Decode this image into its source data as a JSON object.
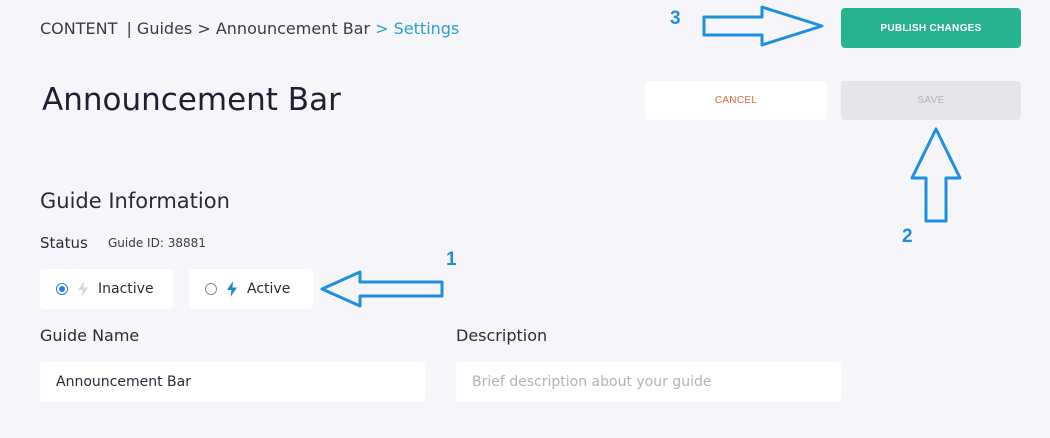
{
  "breadcrumb": {
    "root": "CONTENT",
    "guides": "| Guides",
    "page": "> Announcement Bar",
    "current": "> Settings"
  },
  "page_title": "Announcement Bar",
  "actions": {
    "publish_label": "PUBLISH CHANGES",
    "cancel_label": "CANCEL",
    "save_label": "SAVE"
  },
  "guide_info": {
    "section_title": "Guide Information",
    "status_label": "Status",
    "guide_id": "Guide ID: 38881",
    "status_options": [
      {
        "label": "Inactive",
        "selected": true,
        "icon": "bolt-icon"
      },
      {
        "label": "Active",
        "selected": false,
        "icon": "bolt-icon"
      }
    ]
  },
  "fields": {
    "name_label": "Guide Name",
    "name_value": "Announcement Bar",
    "description_label": "Description",
    "description_placeholder": "Brief description about your guide"
  },
  "annotations": {
    "one": "1",
    "two": "2",
    "three": "3"
  },
  "colors": {
    "publish": "#27b38f",
    "cancel_text": "#e0693f",
    "accent": "#2a9fd6",
    "annotation": "#1d8fe0"
  }
}
